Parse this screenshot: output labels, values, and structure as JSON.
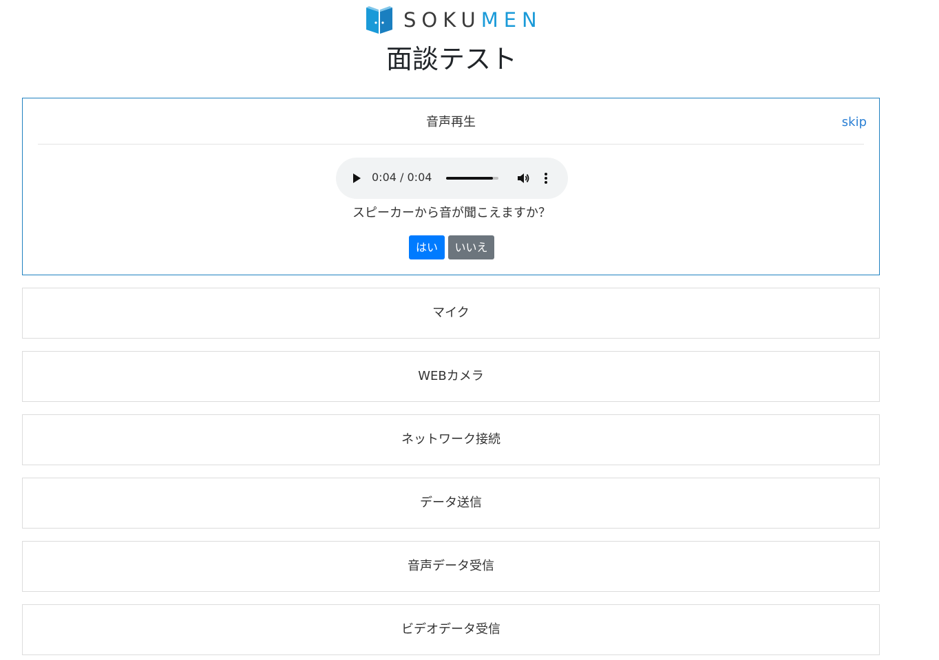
{
  "brand": {
    "logo_text_dark": "SOKU",
    "logo_text_accent_m": "M",
    "logo_text_accent_rest": "EN",
    "logo_icon": "door-logo-icon",
    "colors": {
      "dark": "#3a3a3a",
      "accent": "#1a9ad8"
    }
  },
  "page": {
    "title": "面談テスト"
  },
  "active_step": {
    "title": "音声再生",
    "skip_label": "skip",
    "audio": {
      "time_display": "0:04 / 0:04",
      "progress": 0.9
    },
    "question": "スピーカーから音が聞こえますか？",
    "yes_label": "はい",
    "no_label": "いいえ"
  },
  "steps": [
    {
      "title": "マイク"
    },
    {
      "title": "WEBカメラ"
    },
    {
      "title": "ネットワーク接続"
    },
    {
      "title": "データ送信"
    },
    {
      "title": "音声データ受信"
    },
    {
      "title": "ビデオデータ受信"
    }
  ],
  "colors": {
    "primary": "#007bff",
    "secondary": "#6c757d",
    "active_border": "#1e80c0",
    "link": "#2a7fd4"
  }
}
